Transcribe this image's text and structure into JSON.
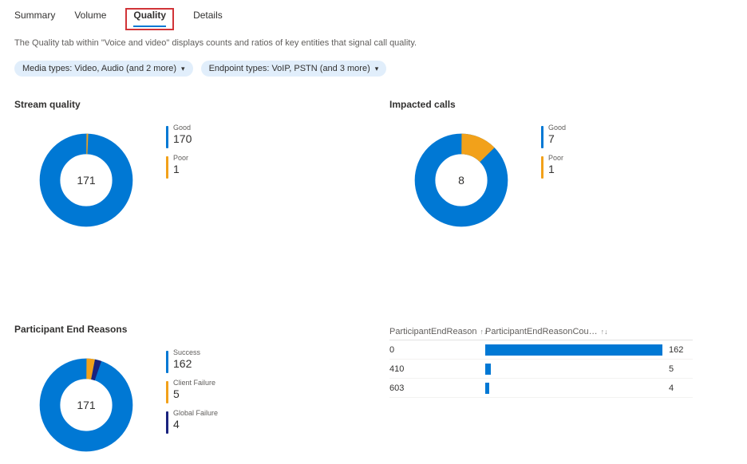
{
  "tabs": [
    "Summary",
    "Volume",
    "Quality",
    "Details"
  ],
  "active_tab": "Quality",
  "description": "The Quality tab within \"Voice and video\" displays counts and ratios of key entities that signal call quality.",
  "filters": {
    "media": "Media types: Video, Audio (and 2 more)",
    "endpoint": "Endpoint types: VoIP, PSTN (and 3 more)"
  },
  "stream_quality": {
    "title": "Stream quality",
    "total": 171,
    "items": [
      {
        "label": "Good",
        "value": 170,
        "color": "#0078d4"
      },
      {
        "label": "Poor",
        "value": 1,
        "color": "#f2a11a"
      }
    ]
  },
  "impacted_calls": {
    "title": "Impacted calls",
    "total": 8,
    "items": [
      {
        "label": "Good",
        "value": 7,
        "color": "#0078d4"
      },
      {
        "label": "Poor",
        "value": 1,
        "color": "#f2a11a"
      }
    ]
  },
  "participant_end_reasons": {
    "title": "Participant End Reasons",
    "total": 171,
    "items": [
      {
        "label": "Success",
        "value": 162,
        "color": "#0078d4"
      },
      {
        "label": "Client Failure",
        "value": 5,
        "color": "#f2a11a"
      },
      {
        "label": "Global Failure",
        "value": 4,
        "color": "#1a237e"
      }
    ]
  },
  "end_reason_table": {
    "columns": [
      "ParticipantEndReason",
      "ParticipantEndReasonCou…"
    ],
    "max": 162,
    "rows": [
      {
        "reason": "0",
        "count": 162
      },
      {
        "reason": "410",
        "count": 5
      },
      {
        "reason": "603",
        "count": 4
      }
    ]
  },
  "chart_data": [
    {
      "type": "pie",
      "title": "Stream quality",
      "categories": [
        "Good",
        "Poor"
      ],
      "values": [
        170,
        1
      ],
      "total": 171
    },
    {
      "type": "pie",
      "title": "Impacted calls",
      "categories": [
        "Good",
        "Poor"
      ],
      "values": [
        7,
        1
      ],
      "total": 8
    },
    {
      "type": "pie",
      "title": "Participant End Reasons",
      "categories": [
        "Success",
        "Client Failure",
        "Global Failure"
      ],
      "values": [
        162,
        5,
        4
      ],
      "total": 171
    },
    {
      "type": "bar",
      "title": "ParticipantEndReason counts",
      "categories": [
        "0",
        "410",
        "603"
      ],
      "values": [
        162,
        5,
        4
      ],
      "xlabel": "ParticipantEndReason",
      "ylabel": "ParticipantEndReasonCount"
    }
  ]
}
